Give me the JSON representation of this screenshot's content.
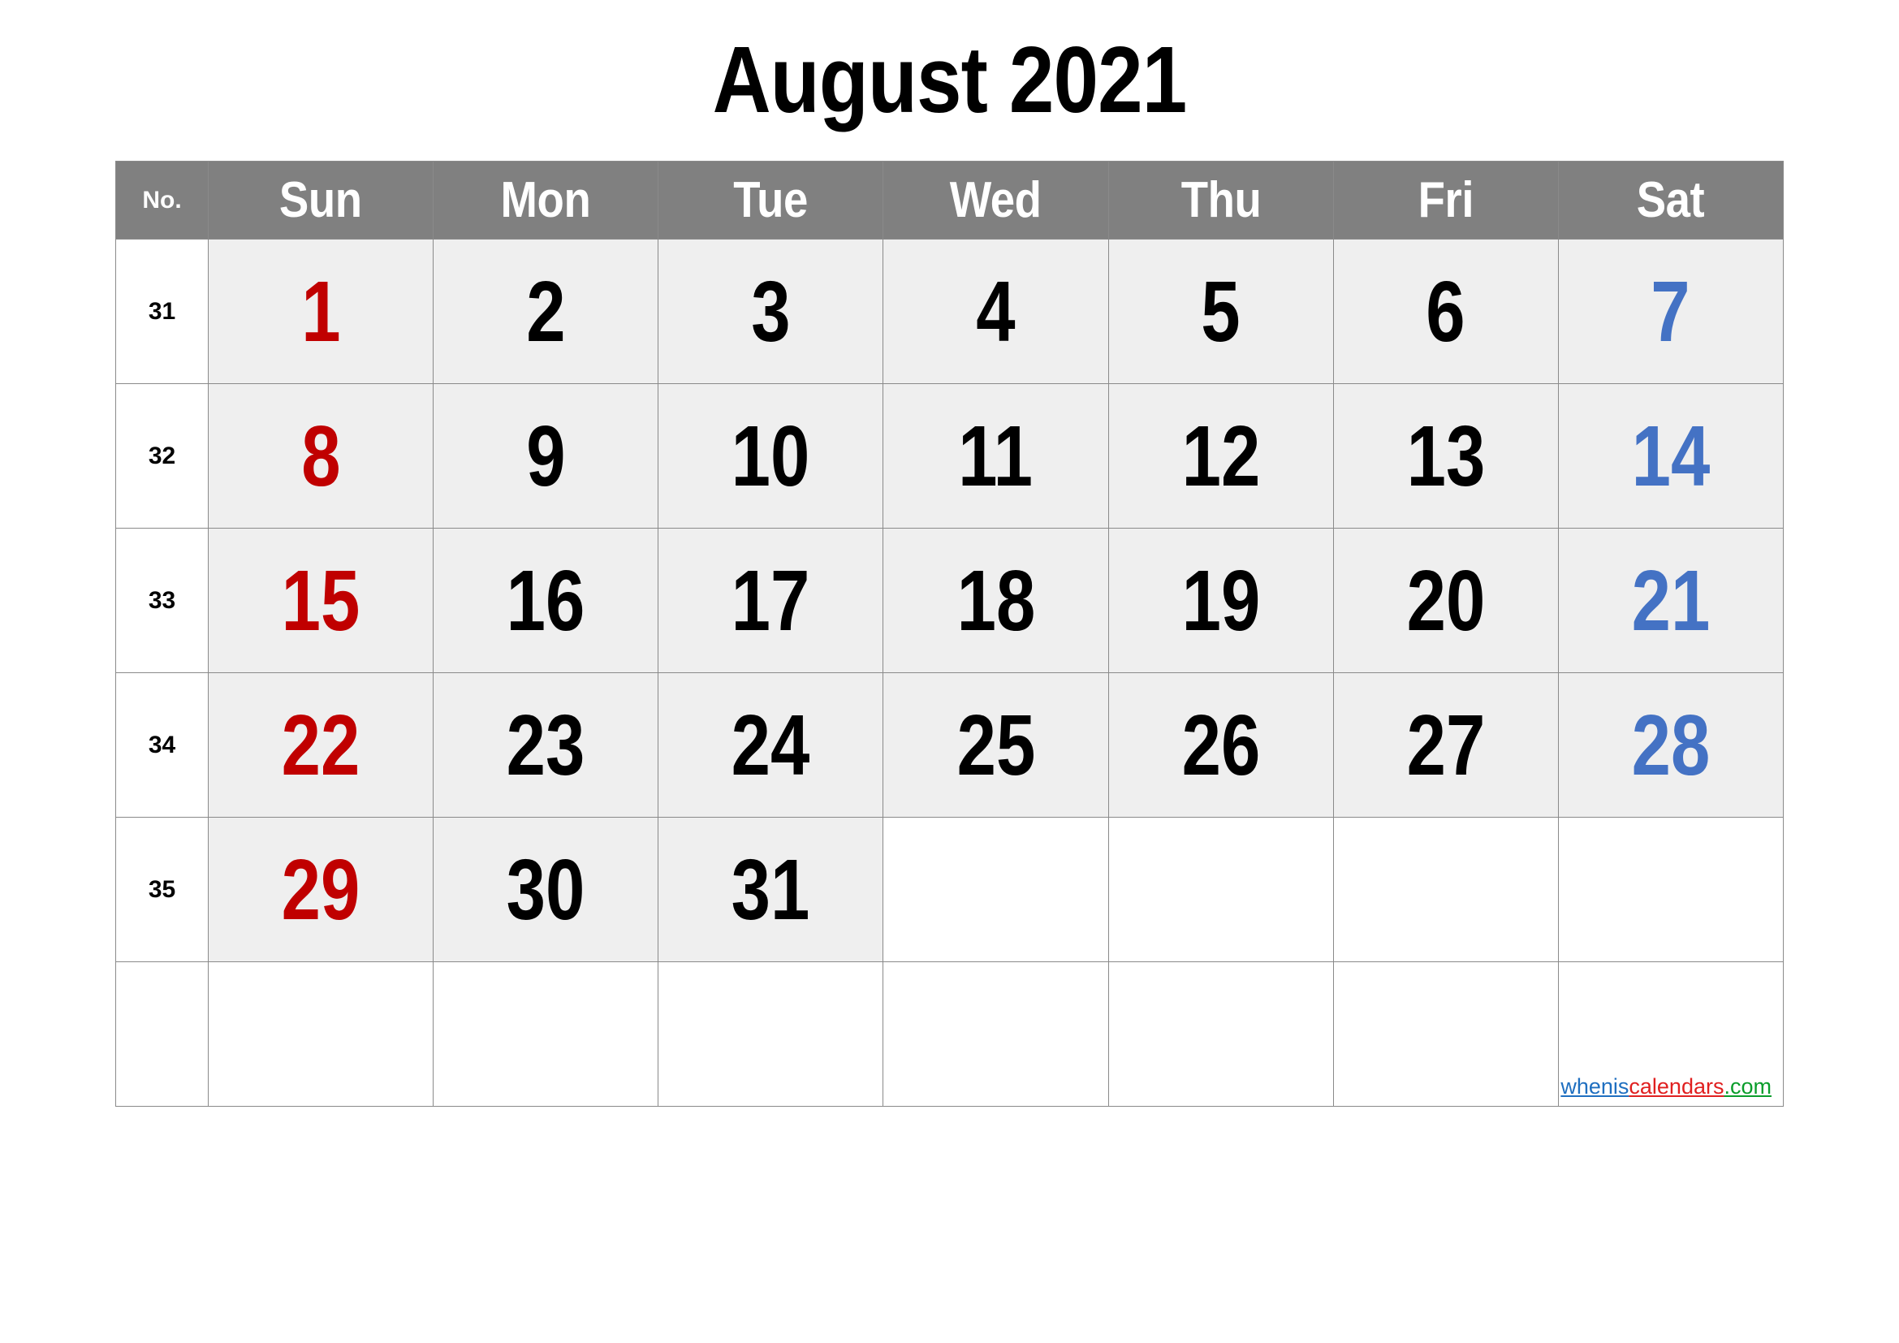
{
  "title": "August 2021",
  "header": {
    "week_number_label": "No.",
    "days": [
      "Sun",
      "Mon",
      "Tue",
      "Wed",
      "Thu",
      "Fri",
      "Sat"
    ]
  },
  "colors": {
    "header_background": "#808080",
    "header_text": "#ffffff",
    "day_cell_background": "#efefef",
    "empty_cell_background": "#ffffff",
    "sunday_text": "#c00000",
    "saturday_text": "#4472c4",
    "weekday_text": "#000000",
    "grid_line": "#8a8a8a",
    "watermark_blue": "#1f6fc0",
    "watermark_red": "#e02020",
    "watermark_green": "#0a9d2b"
  },
  "weeks": [
    {
      "no": "31",
      "days": [
        "1",
        "2",
        "3",
        "4",
        "5",
        "6",
        "7"
      ]
    },
    {
      "no": "32",
      "days": [
        "8",
        "9",
        "10",
        "11",
        "12",
        "13",
        "14"
      ]
    },
    {
      "no": "33",
      "days": [
        "15",
        "16",
        "17",
        "18",
        "19",
        "20",
        "21"
      ]
    },
    {
      "no": "34",
      "days": [
        "22",
        "23",
        "24",
        "25",
        "26",
        "27",
        "28"
      ]
    },
    {
      "no": "35",
      "days": [
        "29",
        "30",
        "31",
        "",
        "",
        "",
        ""
      ]
    },
    {
      "no": "",
      "days": [
        "",
        "",
        "",
        "",
        "",
        "",
        ""
      ]
    }
  ],
  "watermark": {
    "part1": "whenis",
    "part2": "calendars",
    "part3": ".com"
  }
}
